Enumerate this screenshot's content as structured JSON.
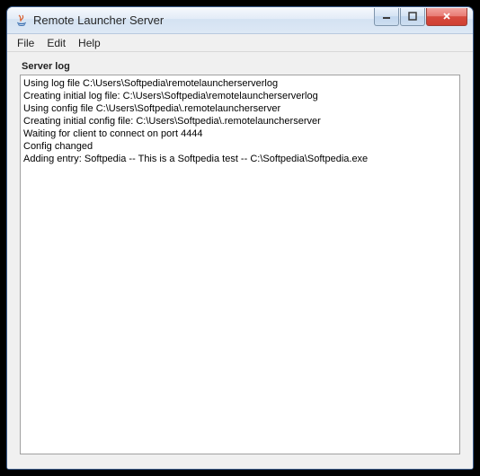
{
  "window": {
    "title": "Remote Launcher Server"
  },
  "menu": {
    "file": "File",
    "edit": "Edit",
    "help": "Help"
  },
  "panel": {
    "label": "Server log"
  },
  "log": {
    "lines": [
      "Using log file C:\\Users\\Softpedia\\remotelauncherserverlog",
      "Creating initial log file: C:\\Users\\Softpedia\\remotelauncherserverlog",
      "Using config file C:\\Users\\Softpedia\\.remotelauncherserver",
      "Creating initial config file: C:\\Users\\Softpedia\\.remotelauncherserver",
      "Waiting for client to connect on port 4444",
      "Config changed",
      "Adding entry: Softpedia -- This is a Softpedia test -- C:\\Softpedia\\Softpedia.exe"
    ]
  }
}
